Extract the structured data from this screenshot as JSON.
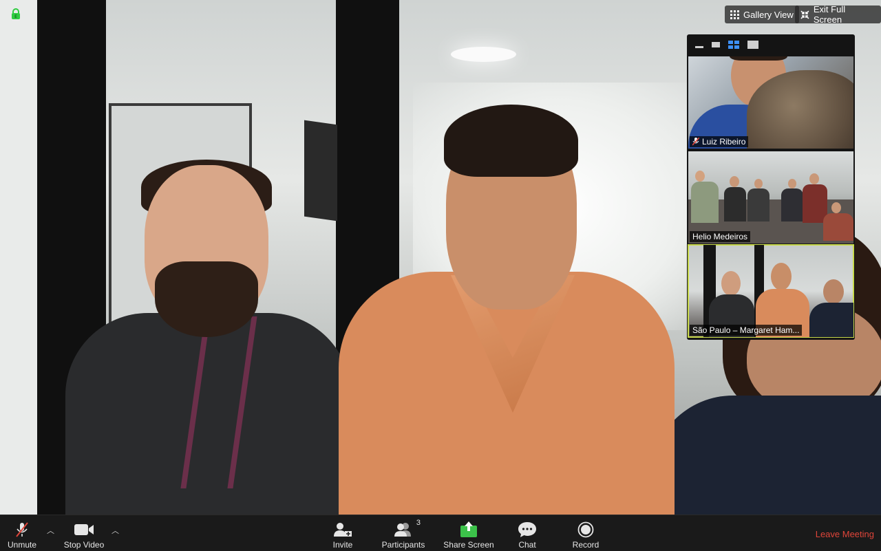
{
  "top_bar": {
    "gallery_view_label": "Gallery View",
    "exit_full_screen_label": "Exit Full Screen"
  },
  "thumbnails": [
    {
      "name": "Luiz Ribeiro",
      "muted": true
    },
    {
      "name": "Helio Medeiros",
      "muted": false
    },
    {
      "name": "São Paulo – Margaret Ham...",
      "muted": false,
      "active_speaker": true
    }
  ],
  "toolbar": {
    "unmute_label": "Unmute",
    "stop_video_label": "Stop Video",
    "invite_label": "Invite",
    "participants_label": "Participants",
    "participants_count": "3",
    "share_screen_label": "Share Screen",
    "chat_label": "Chat",
    "record_label": "Record",
    "leave_label": "Leave Meeting"
  },
  "colors": {
    "share_green": "#3cc24a",
    "leave_red": "#e0453a",
    "active_outline": "#c8d94a",
    "layout_icon_blue": "#3d8ff7",
    "encryption_green": "#2ecc40"
  }
}
